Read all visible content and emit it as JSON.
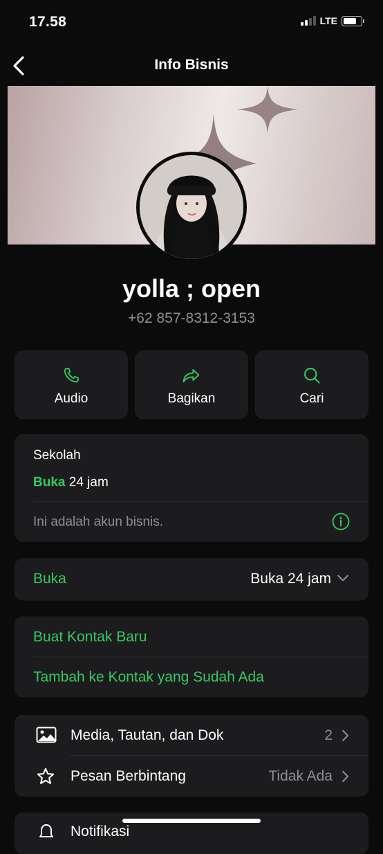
{
  "status_bar": {
    "time": "17.58",
    "network": "LTE"
  },
  "nav": {
    "title": "Info Bisnis"
  },
  "profile": {
    "name": "yolla ; open",
    "phone": "+62 857-8312-3153"
  },
  "actions": [
    {
      "label": "Audio",
      "icon": "phone-icon"
    },
    {
      "label": "Bagikan",
      "icon": "share-icon"
    },
    {
      "label": "Cari",
      "icon": "search-icon"
    }
  ],
  "business": {
    "category": "Sekolah",
    "hours_status": "Buka",
    "hours_text": "24 jam",
    "note": "Ini adalah akun bisnis."
  },
  "hours_row": {
    "label": "Buka",
    "value": "Buka 24 jam"
  },
  "contact": {
    "new_contact": "Buat Kontak Baru",
    "add_existing": "Tambah ke Kontak yang Sudah Ada"
  },
  "media": {
    "media_label": "Media, Tautan, dan Dok",
    "media_count": "2",
    "starred_label": "Pesan Berbintang",
    "starred_value": "Tidak Ada"
  },
  "notifications": {
    "label": "Notifikasi"
  },
  "colors": {
    "accent": "#36c961",
    "background": "#0b0b0b",
    "card": "#1c1c1e"
  }
}
